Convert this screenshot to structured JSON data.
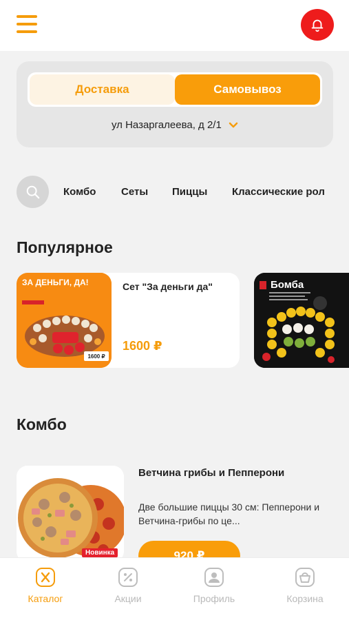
{
  "header": {
    "menu_icon": "hamburger-menu-icon",
    "notification_icon": "bell-icon",
    "notification_color": "#ee1c1c",
    "accent": "#f99d0a"
  },
  "delivery": {
    "tabs": [
      {
        "label": "Доставка",
        "active": false
      },
      {
        "label": "Самовывоз",
        "active": true
      }
    ],
    "address": "ул Назаргалеева, д 2/1"
  },
  "categories": {
    "search_icon": "search-icon",
    "items": [
      "Комбо",
      "Сеты",
      "Пиццы",
      "Классические рол"
    ]
  },
  "popular": {
    "title": "Популярное",
    "items": [
      {
        "name": "Сет \"За деньги да\"",
        "price": "1600 ₽",
        "image_text": "ЗА ДЕНЬГИ, ДА!",
        "image_price": "1600 ₽"
      },
      {
        "image_text": "Бомба"
      }
    ]
  },
  "combo": {
    "title": "Комбо",
    "items": [
      {
        "name": "Ветчина грибы и Пепперони",
        "description": "Две большие пиццы 30 см: Пепперони и Ветчина-грибы по це...",
        "price": "920 ₽",
        "badge": "Новинка"
      }
    ]
  },
  "tabbar": {
    "items": [
      {
        "label": "Каталог",
        "icon": "catalog-icon",
        "active": true
      },
      {
        "label": "Акции",
        "icon": "percent-icon",
        "active": false
      },
      {
        "label": "Профиль",
        "icon": "profile-icon",
        "active": false
      },
      {
        "label": "Корзина",
        "icon": "basket-icon",
        "active": false
      }
    ]
  }
}
